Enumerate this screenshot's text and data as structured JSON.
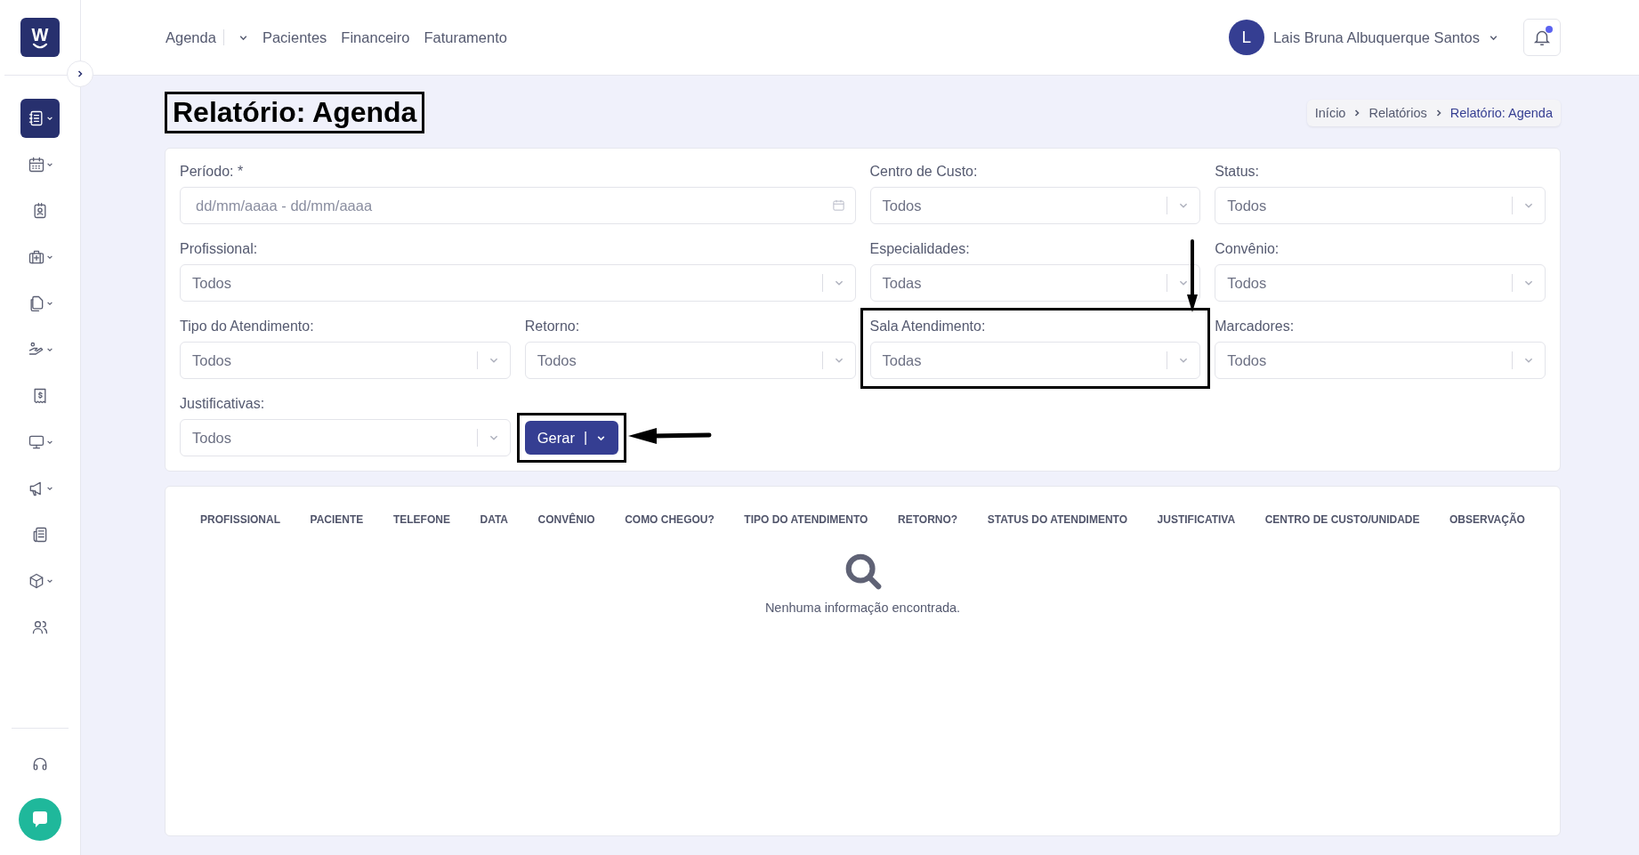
{
  "logo": {
    "letter": "W"
  },
  "top_nav": [
    {
      "label": "Agenda",
      "dropdown": true
    },
    {
      "label": "Pacientes",
      "dropdown": false
    },
    {
      "label": "Financeiro",
      "dropdown": false
    },
    {
      "label": "Faturamento",
      "dropdown": false
    }
  ],
  "user": {
    "initial": "L",
    "name": "Lais Bruna Albuquerque Santos",
    "has_notification": true
  },
  "sidebar": {
    "items": [
      {
        "dropdown": true,
        "selected": true
      },
      {
        "dropdown": true,
        "selected": false
      },
      {
        "dropdown": false,
        "selected": false
      },
      {
        "dropdown": true,
        "selected": false
      },
      {
        "dropdown": true,
        "selected": false
      },
      {
        "dropdown": true,
        "selected": false
      },
      {
        "dropdown": false,
        "selected": false
      },
      {
        "dropdown": true,
        "selected": false
      },
      {
        "dropdown": true,
        "selected": false
      },
      {
        "dropdown": false,
        "selected": false
      },
      {
        "dropdown": true,
        "selected": false
      },
      {
        "dropdown": false,
        "selected": false
      }
    ]
  },
  "page": {
    "title": "Relatório: Agenda",
    "title_highlighted": true
  },
  "breadcrumb": [
    {
      "label": "Início",
      "current": false
    },
    {
      "label": "Relatórios",
      "current": false
    },
    {
      "label": "Relatório: Agenda",
      "current": true
    }
  ],
  "filters": [
    {
      "label": "Período: *",
      "kind": "date",
      "placeholder": "dd/mm/aaaa - dd/mm/aaaa",
      "highlighted": false
    },
    {
      "label": "Centro de Custo:",
      "kind": "select",
      "value": "Todos",
      "highlighted": false
    },
    {
      "label": "Status:",
      "kind": "select",
      "value": "Todos",
      "highlighted": false
    },
    {
      "label": "Profissional:",
      "kind": "select",
      "value": "Todos",
      "highlighted": false
    },
    {
      "label": "Especialidades:",
      "kind": "select",
      "value": "Todas",
      "highlighted": false
    },
    {
      "label": "Convênio:",
      "kind": "select",
      "value": "Todos",
      "highlighted": false
    },
    {
      "label": "Tipo do Atendimento:",
      "kind": "select",
      "value": "Todos",
      "highlighted": false
    },
    {
      "label": "Retorno:",
      "kind": "select",
      "value": "Todos",
      "highlighted": false
    },
    {
      "label": "Sala Atendimento:",
      "kind": "select",
      "value": "Todas",
      "highlighted": true
    },
    {
      "label": "Marcadores:",
      "kind": "select",
      "value": "Todos",
      "highlighted": false
    },
    {
      "label": "Justificativas:",
      "kind": "select",
      "value": "Todos",
      "highlighted": false
    }
  ],
  "generate_button": {
    "label": "Gerar",
    "separator": "|",
    "highlighted": true
  },
  "table": {
    "columns": [
      "PROFISSIONAL",
      "PACIENTE",
      "TELEFONE",
      "DATA",
      "CONVÊNIO",
      "COMO CHEGOU?",
      "TIPO DO ATENDIMENTO",
      "RETORNO?",
      "STATUS DO ATENDIMENTO",
      "JUSTIFICATIVA",
      "CENTRO DE CUSTO/UNIDADE",
      "OBSERVAÇÃO"
    ],
    "empty_message": "Nenhuma informação encontrada."
  }
}
